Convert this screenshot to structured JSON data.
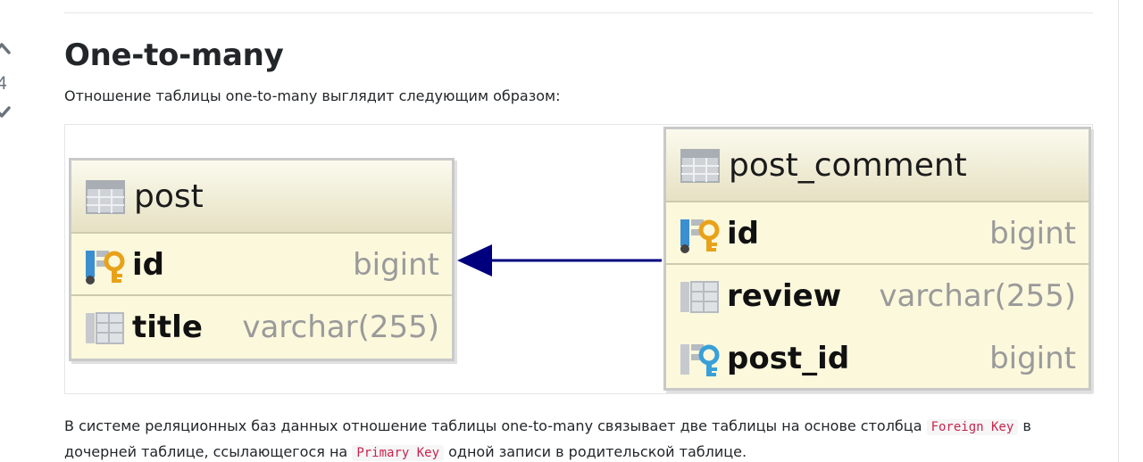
{
  "vote": {
    "count": "4"
  },
  "section": {
    "heading": "One-to-many",
    "intro": "Отношение таблицы one-to-many выглядит следующим образом:"
  },
  "diagram": {
    "tables": {
      "post": {
        "name": "post",
        "columns": [
          {
            "name": "id",
            "type": "bigint",
            "icon": "primary-key-icon"
          },
          {
            "name": "title",
            "type": "varchar(255)",
            "icon": "column-icon"
          }
        ]
      },
      "post_comment": {
        "name": "post_comment",
        "columns": [
          {
            "name": "id",
            "type": "bigint",
            "icon": "primary-key-icon"
          },
          {
            "name": "review",
            "type": "varchar(255)",
            "icon": "column-icon"
          },
          {
            "name": "post_id",
            "type": "bigint",
            "icon": "foreign-key-icon"
          }
        ]
      }
    },
    "colors": {
      "table_fill": "#fbf8dc",
      "arrow": "#00007f",
      "primary_key": "#e8a21a",
      "foreign_key": "#39a0d8"
    }
  },
  "paragraph": {
    "part1": "В системе реляционных баз данных отношение таблицы one-to-many связывает две таблицы на основе столбца ",
    "code1": "Foreign Key",
    "part2": " в дочерней таблице, ссылающегося на ",
    "code2": "Primary Key",
    "part3": " одной записи в родительской таблице."
  }
}
